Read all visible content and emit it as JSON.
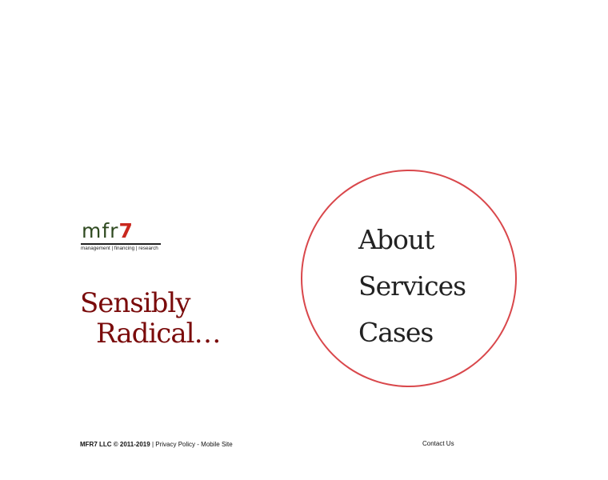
{
  "logo": {
    "word_main": "mfr",
    "word_accent": "7",
    "tagline": "management | financing | research",
    "colors": {
      "word": "#2f4a20",
      "accent": "#c9281f"
    }
  },
  "hero": {
    "tagline_line1": "Sensibly",
    "tagline_line2": "Radical…",
    "color": "#7a0b0b"
  },
  "nav": {
    "circle_color": "#d9474b",
    "items": [
      {
        "label": "About"
      },
      {
        "label": "Services"
      },
      {
        "label": "Cases"
      }
    ]
  },
  "footer": {
    "brand": "MFR7 LLC © 2011-2019",
    "separator": " | ",
    "privacy_label": "Privacy Policy",
    "dash": " - ",
    "mobile_label": "Mobile Site",
    "contact_label": "Contact Us"
  }
}
